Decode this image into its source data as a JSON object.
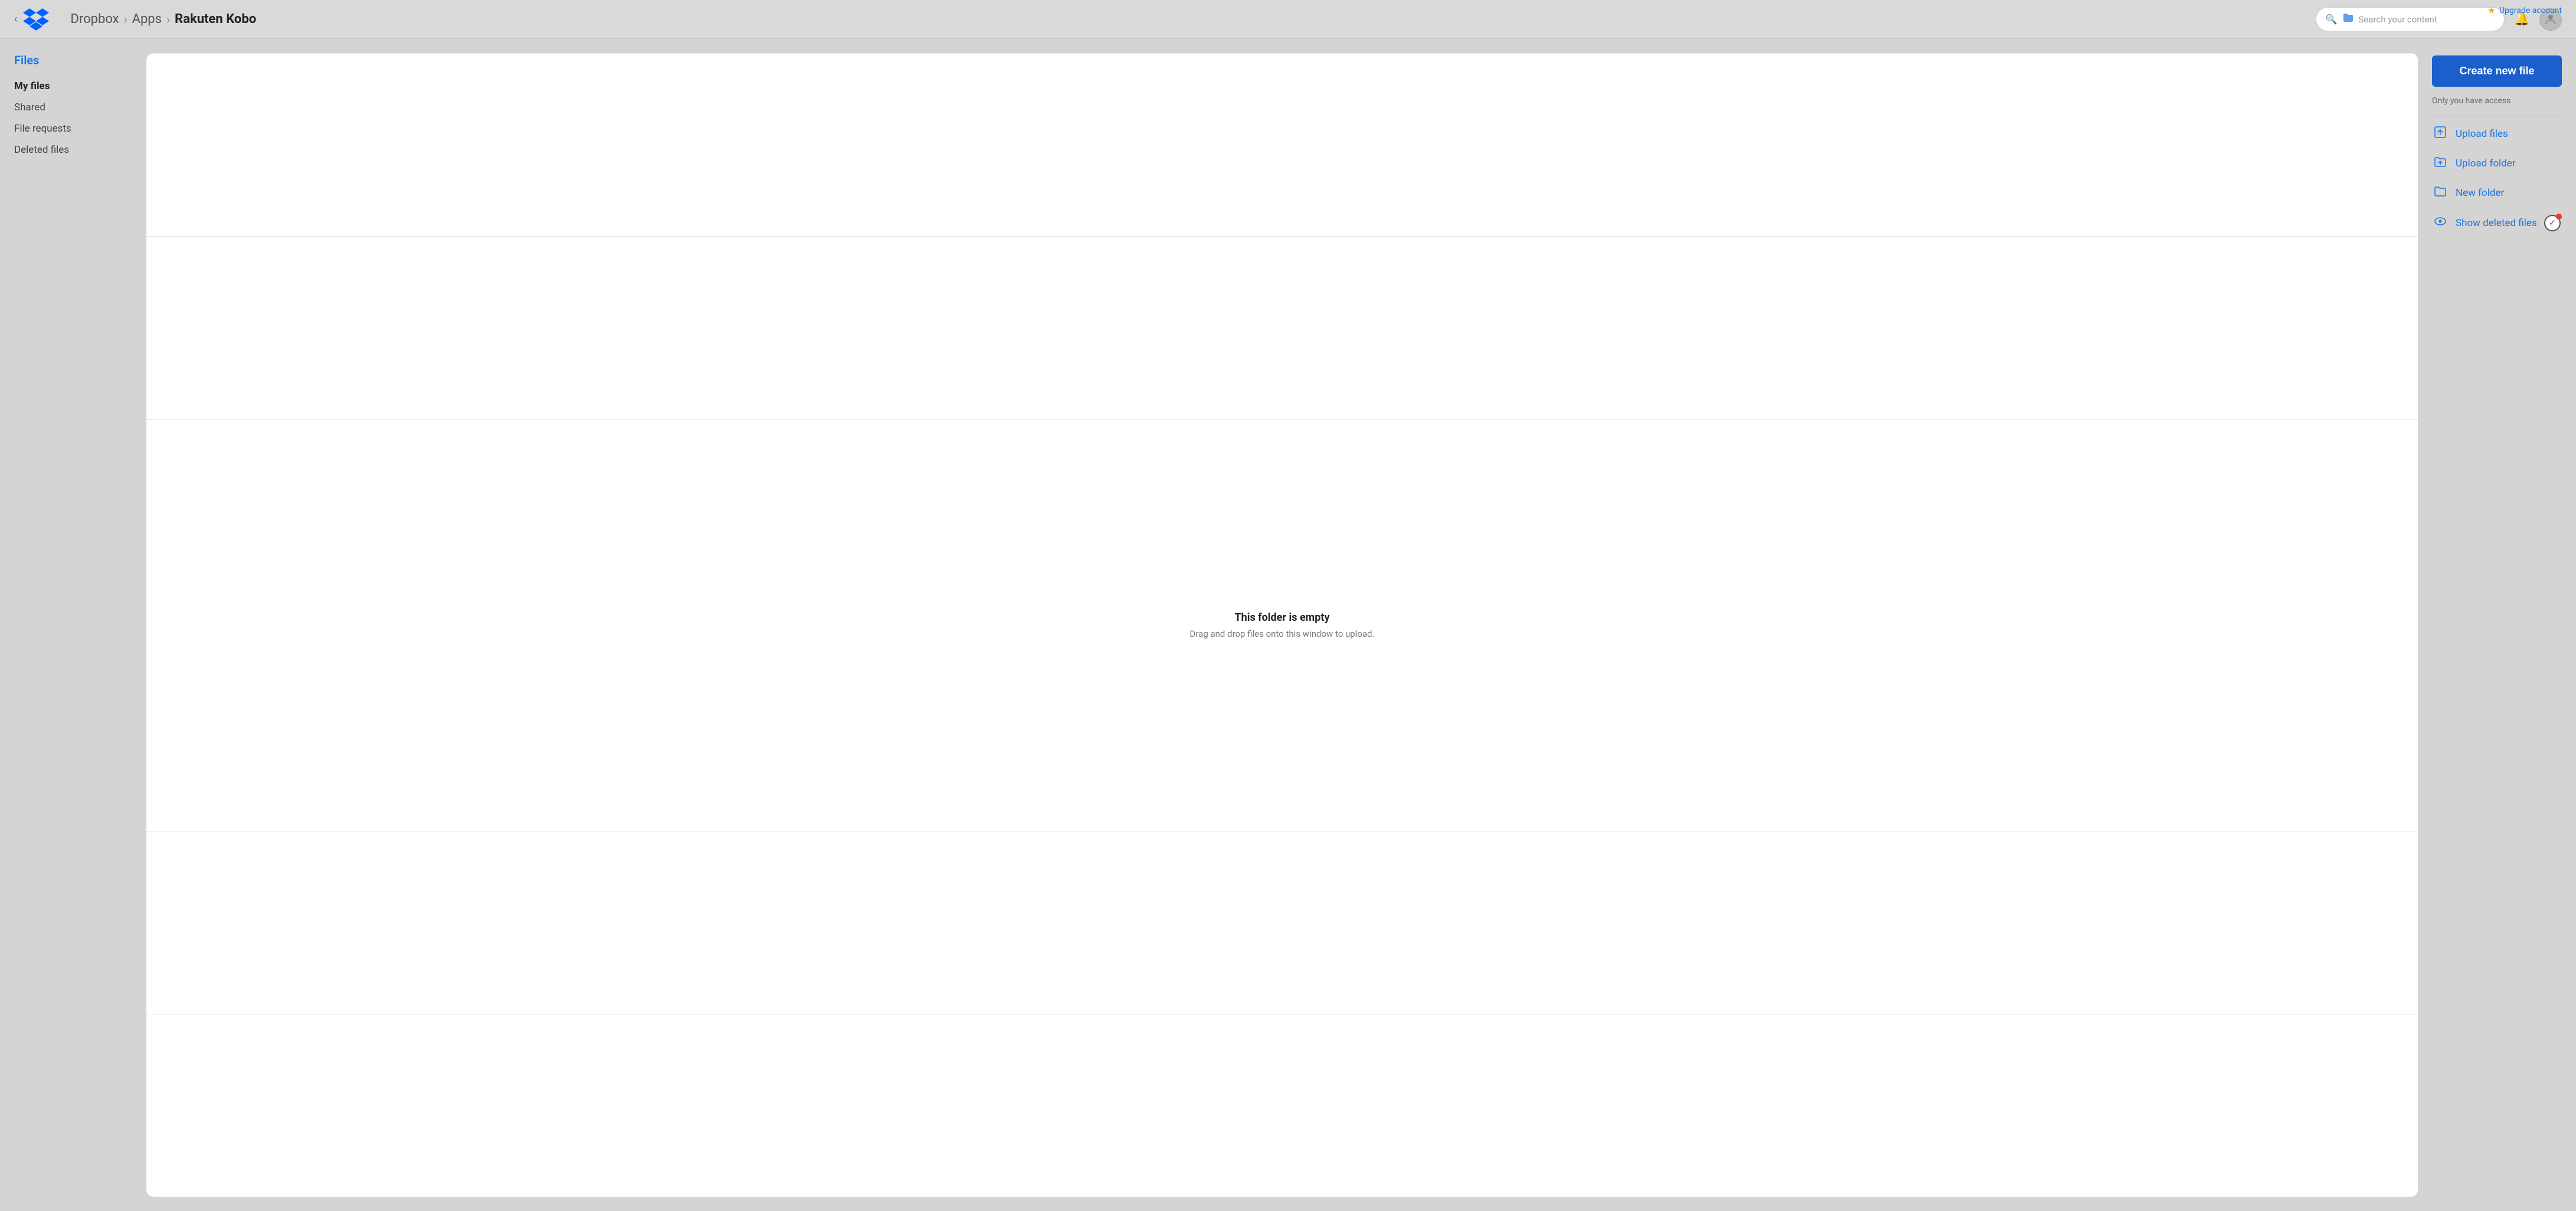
{
  "topbar": {
    "upgrade_label": "Upgrade account",
    "breadcrumb": {
      "part1": "Dropbox",
      "separator1": "›",
      "part2": "Apps",
      "separator2": "›",
      "part3": "Rakuten Kobo"
    },
    "search": {
      "placeholder": "Search your content"
    }
  },
  "sidebar": {
    "section_title": "Files",
    "items": [
      {
        "label": "My files",
        "active": true
      },
      {
        "label": "Shared",
        "active": false
      },
      {
        "label": "File requests",
        "active": false
      },
      {
        "label": "Deleted files",
        "active": false
      }
    ]
  },
  "folder": {
    "empty_title": "This folder is empty",
    "empty_subtitle": "Drag and drop files onto this window to upload."
  },
  "right_panel": {
    "create_button": "Create new file",
    "access_text": "Only you have access",
    "actions": [
      {
        "icon": "upload-files",
        "label": "Upload files"
      },
      {
        "icon": "upload-folder",
        "label": "Upload folder"
      },
      {
        "icon": "new-folder",
        "label": "New folder"
      },
      {
        "icon": "show-deleted",
        "label": "Show deleted files"
      }
    ]
  }
}
